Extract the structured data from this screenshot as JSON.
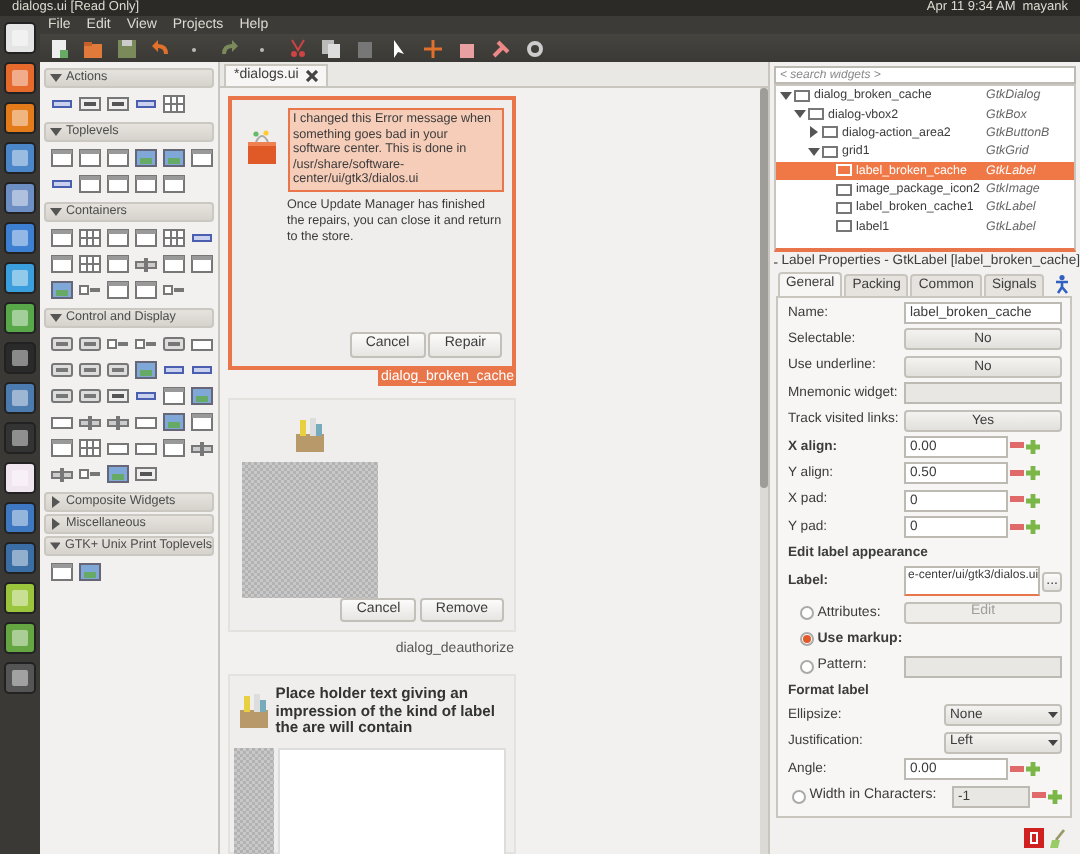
{
  "top_panel": {
    "title": "dialogs.ui [Read Only]",
    "clock": "Apr 11  9:34 AM",
    "user": "mayank"
  },
  "menu": [
    "File",
    "Edit",
    "View",
    "Projects",
    "Help"
  ],
  "palette": [
    {
      "title": "Actions",
      "expanded": true,
      "tools": [
        {
          "kind": "label"
        },
        {
          "kind": "text"
        },
        {
          "kind": "text"
        },
        {
          "kind": "label"
        },
        {
          "kind": "grid"
        }
      ]
    },
    {
      "title": "Toplevels",
      "expanded": true,
      "tools": [
        {
          "kind": "frame"
        },
        {
          "kind": "frame"
        },
        {
          "kind": "frame"
        },
        {
          "kind": "image"
        },
        {
          "kind": "image"
        },
        {
          "kind": "frame"
        },
        {
          "kind": "label"
        },
        {
          "kind": "frame"
        },
        {
          "kind": "frame"
        },
        {
          "kind": "frame"
        },
        {
          "kind": "frame"
        }
      ]
    },
    {
      "title": "Containers",
      "expanded": true,
      "tools": [
        {
          "kind": "frame"
        },
        {
          "kind": "grid"
        },
        {
          "kind": "frame"
        },
        {
          "kind": "frame"
        },
        {
          "kind": "grid"
        },
        {
          "kind": "label"
        },
        {
          "kind": "frame"
        },
        {
          "kind": "grid"
        },
        {
          "kind": "frame"
        },
        {
          "kind": "bar"
        },
        {
          "kind": "frame"
        },
        {
          "kind": "frame"
        },
        {
          "kind": "image"
        },
        {
          "kind": "check"
        },
        {
          "kind": "frame"
        },
        {
          "kind": "frame"
        },
        {
          "kind": "check"
        }
      ]
    },
    {
      "title": "Control and Display",
      "expanded": true,
      "tools": [
        {
          "kind": "button"
        },
        {
          "kind": "button"
        },
        {
          "kind": "check"
        },
        {
          "kind": "check"
        },
        {
          "kind": "button"
        },
        {
          "kind": "entry"
        },
        {
          "kind": "button"
        },
        {
          "kind": "button"
        },
        {
          "kind": "button"
        },
        {
          "kind": "image"
        },
        {
          "kind": "label"
        },
        {
          "kind": "label"
        },
        {
          "kind": "button"
        },
        {
          "kind": "button"
        },
        {
          "kind": "text"
        },
        {
          "kind": "label"
        },
        {
          "kind": "frame"
        },
        {
          "kind": "image"
        },
        {
          "kind": "entry"
        },
        {
          "kind": "bar"
        },
        {
          "kind": "bar"
        },
        {
          "kind": "entry"
        },
        {
          "kind": "image"
        },
        {
          "kind": "frame"
        },
        {
          "kind": "frame"
        },
        {
          "kind": "grid"
        },
        {
          "kind": "entry"
        },
        {
          "kind": "entry"
        },
        {
          "kind": "frame"
        },
        {
          "kind": "bar"
        },
        {
          "kind": "bar"
        },
        {
          "kind": "check"
        },
        {
          "kind": "image"
        },
        {
          "kind": "text"
        }
      ]
    },
    {
      "title": "Composite Widgets",
      "expanded": false
    },
    {
      "title": "Miscellaneous",
      "expanded": false
    },
    {
      "title": "GTK+ Unix Print Toplevels",
      "expanded": true,
      "tools": [
        {
          "kind": "frame"
        },
        {
          "kind": "image"
        }
      ]
    }
  ],
  "document_tab": {
    "label": "*dialogs.ui"
  },
  "dialogs": [
    {
      "kind": "error",
      "selected": true,
      "name": "dialog_broken_cache",
      "highlighted_text": "I changed this Error message when something goes bad in your software center. This is done in /usr/share/software-center/ui/gtk3/dialos.ui",
      "text": "Once Update Manager has finished the repairs, you can close it and return to the store.",
      "buttons": [
        "Cancel",
        "Repair"
      ]
    },
    {
      "kind": "deauthorize",
      "selected": false,
      "name": "dialog_deauthorize",
      "buttons": [
        "Cancel",
        "Remove"
      ]
    },
    {
      "kind": "placeholder",
      "selected": false,
      "heading": "Place holder text giving an impression of the kind of label the are will contain"
    }
  ],
  "inspector": {
    "search_placeholder": "< search widgets >",
    "tree": [
      {
        "name": "dialog_broken_cache",
        "type": "GtkDialog",
        "expanded": true,
        "selected": false,
        "children": [
          {
            "name": "dialog-vbox2",
            "type": "GtkBox",
            "expanded": true,
            "selected": false,
            "children": [
              {
                "name": "dialog-action_area2",
                "type": "GtkButtonB",
                "expanded": false,
                "selected": false
              },
              {
                "name": "grid1",
                "type": "GtkGrid",
                "expanded": true,
                "selected": false,
                "children": [
                  {
                    "name": "label_broken_cache",
                    "type": "GtkLabel",
                    "selected": true
                  },
                  {
                    "name": "image_package_icon2",
                    "type": "GtkImage",
                    "selected": false
                  },
                  {
                    "name": "label_broken_cache1",
                    "type": "GtkLabel",
                    "selected": false
                  },
                  {
                    "name": "label1",
                    "type": "GtkLabel",
                    "selected": false
                  }
                ]
              }
            ]
          }
        ]
      }
    ]
  },
  "properties": {
    "title": "Label Properties - GtkLabel [label_broken_cache]",
    "tabs": [
      {
        "label": "General",
        "selected": true
      },
      {
        "label": "Packing",
        "selected": false
      },
      {
        "label": "Common",
        "selected": false
      },
      {
        "label": "Signals",
        "selected": false
      }
    ],
    "rows": [
      {
        "kind": "entry",
        "label": "Name:",
        "value": "label_broken_cache",
        "disabled": false
      },
      {
        "kind": "toggle",
        "label": "Selectable:",
        "value": "No"
      },
      {
        "kind": "toggle",
        "label": "Use underline:",
        "value": "No"
      },
      {
        "kind": "entry",
        "label": "Mnemonic widget:",
        "value": "",
        "disabled": true
      },
      {
        "kind": "toggle",
        "label": "Track visited links:",
        "value": "Yes"
      },
      {
        "kind": "spin",
        "label": "X align:",
        "value": "0.00",
        "emphasized": true
      },
      {
        "kind": "spin",
        "label": "Y align:",
        "value": "0.50",
        "emphasized": false
      },
      {
        "kind": "spin",
        "label": "X pad:",
        "value": "0",
        "emphasized": false
      },
      {
        "kind": "spin",
        "label": "Y pad:",
        "value": "0",
        "emphasized": false
      },
      {
        "kind": "section",
        "label": "Edit label appearance"
      },
      {
        "kind": "picker",
        "label": "Label:",
        "value": "e-center/ui/gtk3/dialos.ui",
        "button": "...",
        "emphasized": true
      },
      {
        "kind": "radio",
        "label": "Attributes:",
        "selected": false,
        "button": "Edit"
      },
      {
        "kind": "radio",
        "label": "Use markup:",
        "selected": true
      },
      {
        "kind": "radio",
        "label": "Pattern:",
        "selected": false,
        "field": true
      },
      {
        "kind": "section",
        "label": "Format label"
      },
      {
        "kind": "combo",
        "label": "Ellipsize:",
        "value": "None"
      },
      {
        "kind": "combo",
        "label": "Justification:",
        "value": "Left"
      },
      {
        "kind": "spin",
        "label": "Angle:",
        "value": "0.00",
        "emphasized": false
      },
      {
        "kind": "check_spin",
        "label": "Width in Characters:",
        "checked": false,
        "value": "-1",
        "disabled": true
      }
    ]
  }
}
